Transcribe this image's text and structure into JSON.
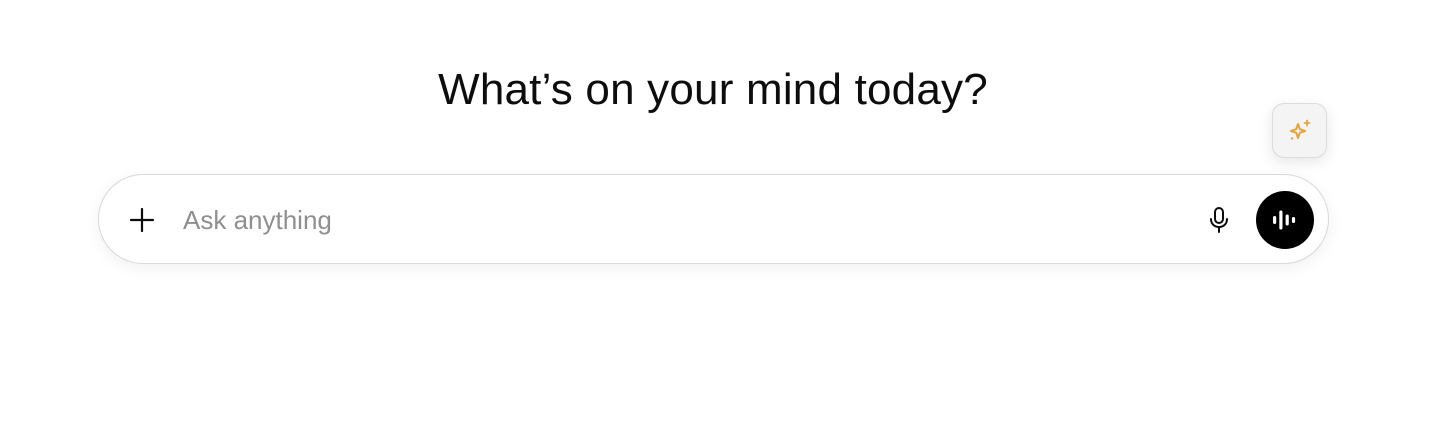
{
  "main": {
    "heading": "What’s on your mind today?"
  },
  "composer": {
    "placeholder": "Ask anything",
    "value": ""
  },
  "icons": {
    "add": "plus-icon",
    "mic": "microphone-icon",
    "voice": "voice-waveform-icon",
    "sparkle": "sparkle-icon"
  },
  "colors": {
    "sparkle_accent": "#e8a33d",
    "voice_button_bg": "#000000",
    "placeholder_text": "#8f8f8f"
  }
}
